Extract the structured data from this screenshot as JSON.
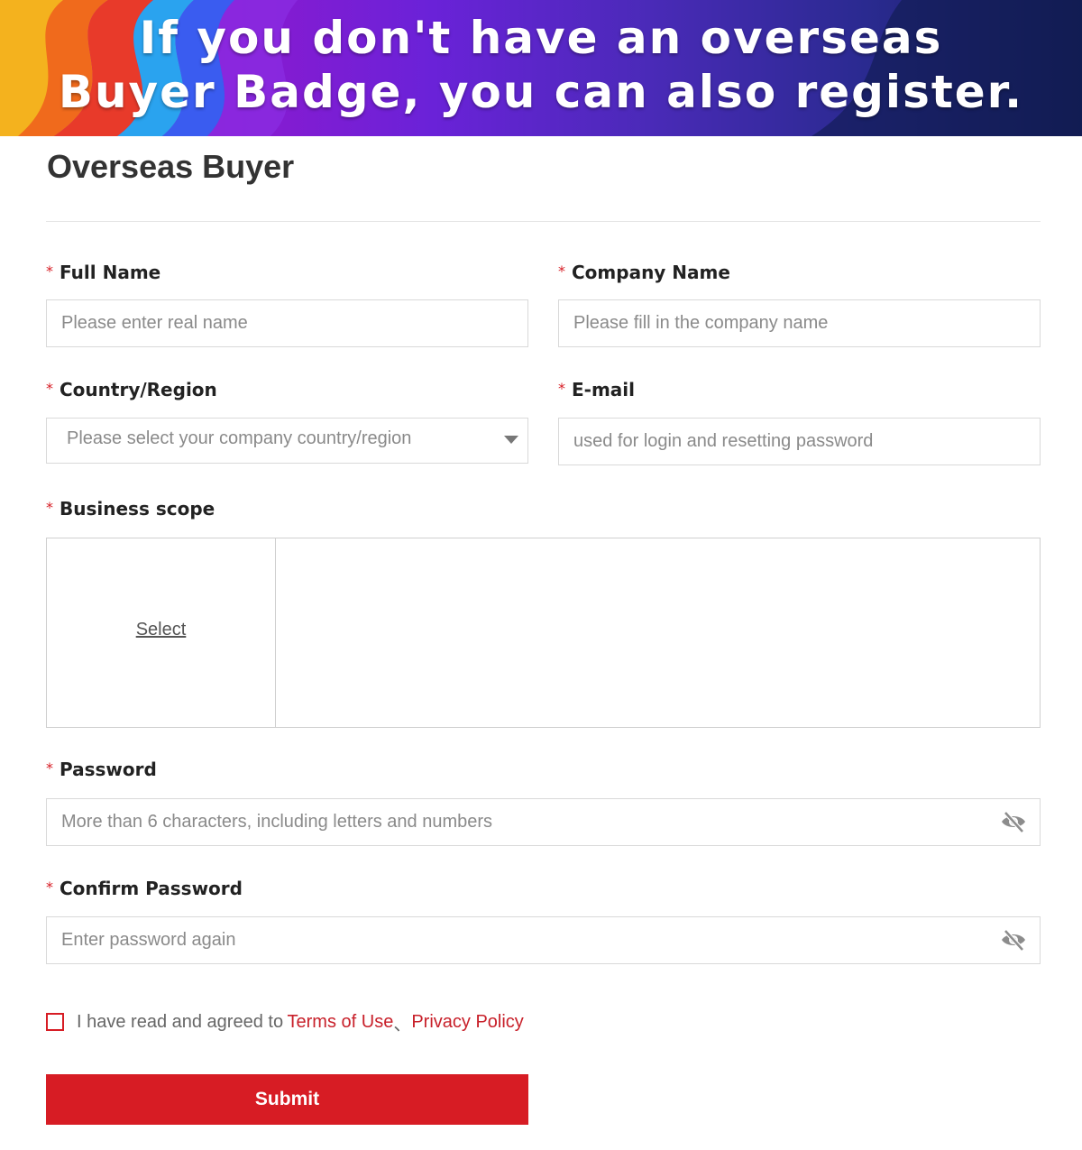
{
  "banner": {
    "line1": "If you don't have an overseas",
    "line2": "Buyer Badge, you can also register."
  },
  "page_title": "Overseas Buyer",
  "required_mark": "*",
  "fields": {
    "full_name": {
      "label": "Full Name",
      "placeholder": "Please enter real name"
    },
    "company_name": {
      "label": "Company Name",
      "placeholder": "Please fill in the company name"
    },
    "country": {
      "label": "Country/Region",
      "placeholder": "Please select your company country/region"
    },
    "email": {
      "label": "E-mail",
      "placeholder": "used for login and resetting password"
    },
    "business_scope": {
      "label": "Business scope",
      "select_label": "Select"
    },
    "password": {
      "label": "Password",
      "placeholder": "More than 6 characters, including letters and numbers"
    },
    "confirm_password": {
      "label": "Confirm Password",
      "placeholder": "Enter password again"
    }
  },
  "agreement": {
    "text": "I have read and agreed to",
    "terms": "Terms of Use",
    "separator": "、",
    "privacy": "Privacy Policy",
    "checked": false
  },
  "submit_label": "Submit",
  "icons": {
    "password_toggle": "eye-slash-icon",
    "dropdown": "caret-down-icon"
  },
  "colors": {
    "accent": "#d71c24",
    "link": "#c8202a"
  }
}
